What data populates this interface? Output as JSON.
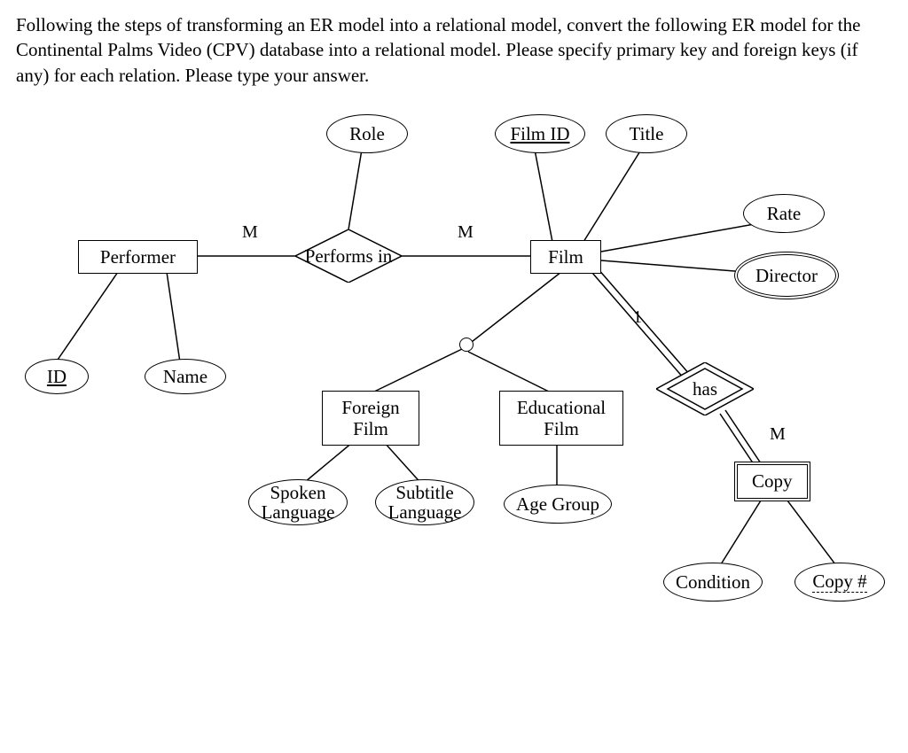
{
  "prompt_text": "Following the steps of transforming an ER model into a relational model, convert the following ER model for the Continental Palms Video (CPV) database into a relational model. Please specify primary key and foreign keys (if any) for each relation. Please type your answer.",
  "entities": {
    "performer": "Performer",
    "film": "Film",
    "foreign_film_l1": "Foreign",
    "foreign_film_l2": "Film",
    "educational_film_l1": "Educational",
    "educational_film_l2": "Film",
    "copy": "Copy"
  },
  "relationships": {
    "performs_in": "Performs in",
    "has": "has"
  },
  "attributes": {
    "role": "Role",
    "film_id": "Film ID",
    "title": "Title",
    "rate": "Rate",
    "director": "Director",
    "id": "ID",
    "name": "Name",
    "spoken_language_l1": "Spoken",
    "spoken_language_l2": "Language",
    "subtitle_language_l1": "Subtitle",
    "subtitle_language_l2": "Language",
    "age_group": "Age Group",
    "condition": "Condition",
    "copy_no": "Copy #"
  },
  "cardinalities": {
    "performer_performs": "M",
    "performs_film": "M",
    "film_has": "1",
    "has_copy": "M"
  }
}
